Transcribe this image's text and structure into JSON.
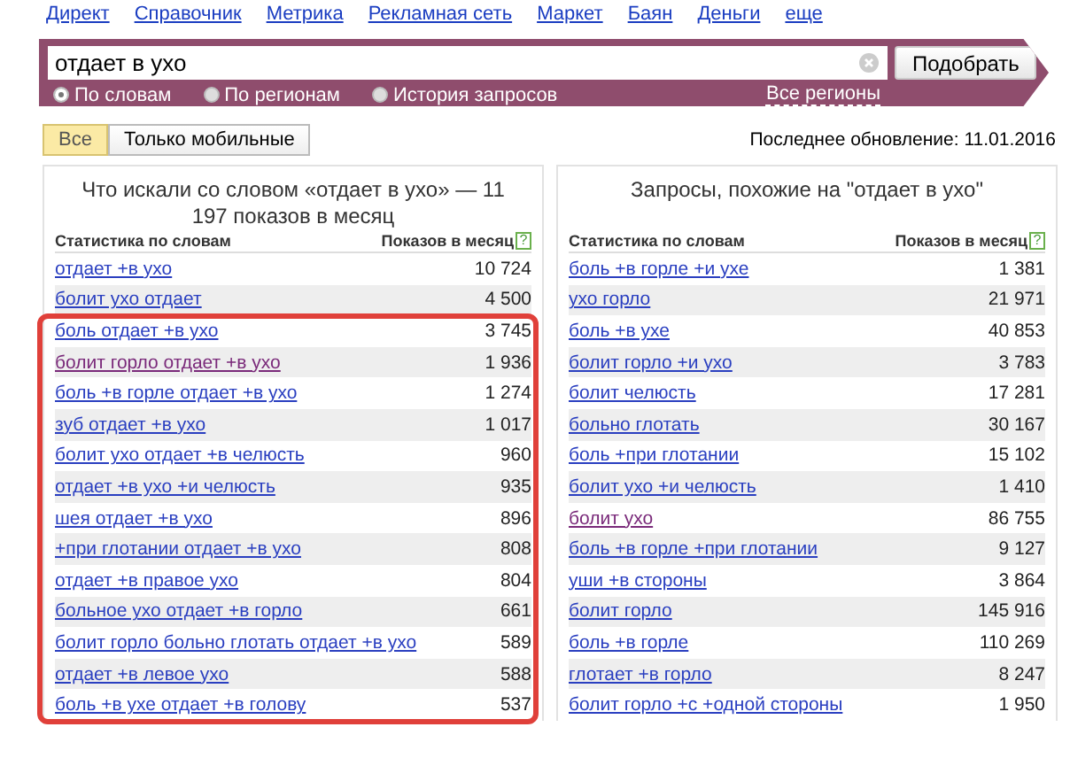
{
  "top_nav": [
    "Директ",
    "Справочник",
    "Метрика",
    "Рекламная сеть",
    "Маркет",
    "Баян",
    "Деньги",
    "еще"
  ],
  "search": {
    "value": "отдает в ухо",
    "button": "Подобрать",
    "modes": [
      {
        "label": "По словам",
        "selected": true
      },
      {
        "label": "По регионам",
        "selected": false
      },
      {
        "label": "История запросов",
        "selected": false
      }
    ],
    "regions_link": "Все регионы"
  },
  "filter_tabs": [
    {
      "label": "Все",
      "selected": true
    },
    {
      "label": "Только мобильные",
      "selected": false
    }
  ],
  "last_update": "Последнее обновление: 11.01.2016",
  "left_panel": {
    "title": "Что искали со словом «отдает в ухо» — 11 197 показов в месяц",
    "columns": [
      "Статистика по словам",
      "Показов в месяц"
    ],
    "help": "?",
    "rows": [
      {
        "phrase": "отдает +в ухо",
        "count": "10 724",
        "visited": false
      },
      {
        "phrase": "болит ухо отдает",
        "count": "4 500",
        "visited": false
      }
    ],
    "highlighted_rows": [
      {
        "phrase": "боль отдает +в ухо",
        "count": "3 745",
        "visited": false
      },
      {
        "phrase": "болит горло отдает +в ухо",
        "count": "1 936",
        "visited": true
      },
      {
        "phrase": "боль +в горле отдает +в ухо",
        "count": "1 274",
        "visited": false
      },
      {
        "phrase": "зуб отдает +в ухо",
        "count": "1 017",
        "visited": false
      },
      {
        "phrase": "болит ухо отдает +в челюсть",
        "count": "960",
        "visited": false
      },
      {
        "phrase": "отдает +в ухо +и челюсть",
        "count": "935",
        "visited": false
      },
      {
        "phrase": "шея отдает +в ухо",
        "count": "896",
        "visited": false
      },
      {
        "phrase": "+при глотании отдает +в ухо",
        "count": "808",
        "visited": false
      },
      {
        "phrase": "отдает +в правое ухо",
        "count": "804",
        "visited": false
      },
      {
        "phrase": "больное ухо отдает +в горло",
        "count": "661",
        "visited": false
      },
      {
        "phrase": "болит горло больно глотать отдает +в ухо",
        "count": "589",
        "visited": false
      },
      {
        "phrase": "отдает +в левое ухо",
        "count": "588",
        "visited": false
      },
      {
        "phrase": "боль +в ухе отдает +в голову",
        "count": "537",
        "visited": false
      }
    ]
  },
  "right_panel": {
    "title": "Запросы, похожие на \"отдает в ухо\"",
    "columns": [
      "Статистика по словам",
      "Показов в месяц"
    ],
    "help": "?",
    "rows": [
      {
        "phrase": "боль +в горле +и ухе",
        "count": "1 381",
        "visited": false
      },
      {
        "phrase": "ухо горло",
        "count": "21 971",
        "visited": false
      },
      {
        "phrase": "боль +в ухе",
        "count": "40 853",
        "visited": false
      },
      {
        "phrase": "болит горло +и ухо",
        "count": "3 783",
        "visited": false
      },
      {
        "phrase": "болит челюсть",
        "count": "17 281",
        "visited": false
      },
      {
        "phrase": "больно глотать",
        "count": "30 167",
        "visited": false
      },
      {
        "phrase": "боль +при глотании",
        "count": "15 102",
        "visited": false
      },
      {
        "phrase": "болит ухо +и челюсть",
        "count": "1 410",
        "visited": false
      },
      {
        "phrase": "болит ухо",
        "count": "86 755",
        "visited": true
      },
      {
        "phrase": "боль +в горле +при глотании",
        "count": "9 127",
        "visited": false
      },
      {
        "phrase": "уши +в стороны",
        "count": "3 864",
        "visited": false
      },
      {
        "phrase": "болит горло",
        "count": "145 916",
        "visited": false
      },
      {
        "phrase": "боль +в горле",
        "count": "110 269",
        "visited": false
      },
      {
        "phrase": "глотает +в горло",
        "count": "8 247",
        "visited": false
      },
      {
        "phrase": "болит горло +с +одной стороны",
        "count": "1 950",
        "visited": false
      }
    ]
  }
}
